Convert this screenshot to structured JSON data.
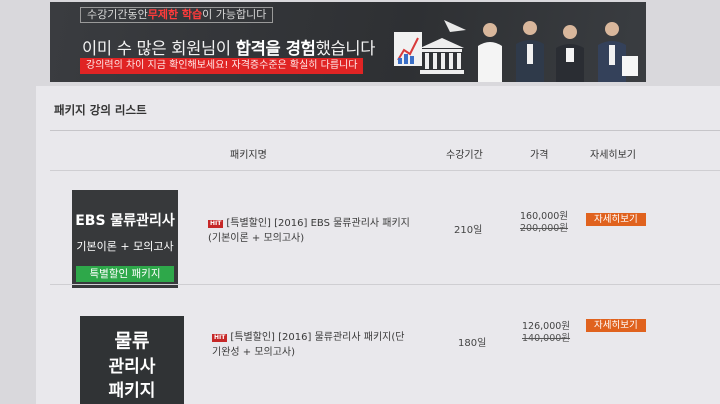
{
  "banner": {
    "tag_prefix": "수강기간동안",
    "tag_highlight": "무제한 학습",
    "tag_suffix": "이 가능합니다",
    "headline_prefix": "이미 수 많은 회원님이 ",
    "headline_bold": "합격을 경험",
    "headline_suffix": "했습니다",
    "note": "강의력의 차이 지금 확인해보세요! 자격증수준은 확실히 다릅니다"
  },
  "section": {
    "title": "패키지 강의 리스트"
  },
  "table": {
    "headers": {
      "name": "패키지명",
      "period": "수강기간",
      "price": "가격",
      "detail": "자세히보기"
    }
  },
  "rows": [
    {
      "thumb_title": "EBS 물류관리사",
      "thumb_sub": "기본이론 + 모의고사",
      "thumb_bar": "특별할인 패키지",
      "hit": "HIT",
      "name_line1": "[특별할인] [2016] EBS 물류관리사 패키지",
      "name_line2": "(기본이론 + 모의고사)",
      "period": "210일",
      "price": "160,000원",
      "original_price": "200,000원",
      "detail_button": "자세히보기"
    },
    {
      "thumb_line1": "물류",
      "thumb_line2": "관리사",
      "thumb_line3": "패키지",
      "hit": "HIT",
      "name_line1": "[특별할인] [2016] 물류관리사 패키지(단",
      "name_line2": "기완성 + 모의고사)",
      "period": "180일",
      "price": "126,000원",
      "original_price": "140,000원",
      "detail_button": "자세히보기"
    }
  ],
  "colors": {
    "accent_orange": "#e0621e",
    "hit_red": "#c62828",
    "banner_red": "#e02424",
    "package_green": "#2ea84a"
  }
}
